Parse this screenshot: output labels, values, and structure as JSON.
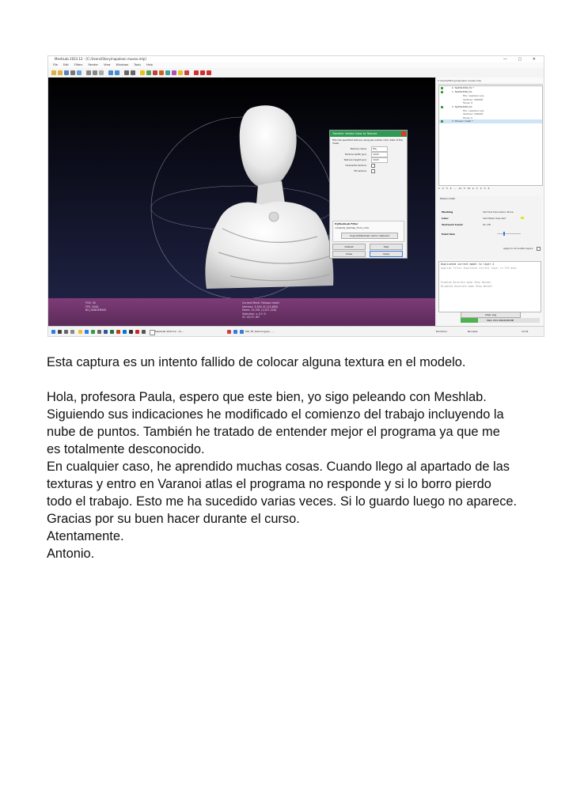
{
  "screenshot": {
    "window_title": "MeshLab 2023.12 - [C:/Users/iStory/napoleon museo.mlp]",
    "menu": [
      "File",
      "Edit",
      "Filters",
      "Render",
      "View",
      "Windows",
      "Tools",
      "Help"
    ],
    "window_controls": "—  ▢  ✕",
    "viewport_info_left": [
      "FOV: 30",
      "FPS: 2000",
      "BO_RENDERING"
    ],
    "viewport_info_right": [
      "Current Mesh: Poisson mesh",
      "Vertices: 3,540 (5,113,680)",
      "Faces: 15,291 (1,027,220)",
      "Selection: v: 0 f: 0",
      "VC VQ FC WT"
    ],
    "dialog": {
      "title": "Transfer: Vertex Color to Texture",
      "description": "Fills the specified texture using per-vertex color data of the mesh.",
      "fields": [
        {
          "label": "Texture name",
          "value": "file_"
        },
        {
          "label": "Texture width (px)",
          "value": "1024"
        },
        {
          "label": "Texture height (px)",
          "value": "1024"
        }
      ],
      "checks": [
        "Overwrite texture",
        "Fill texture"
      ],
      "group_title": "PyMeshLab Filter",
      "group_line": "compute_texmap_from_color",
      "group_button": "Copy PyMeshLab call to clipboard",
      "buttons": [
        "Default",
        "Help",
        "Close",
        "Apply"
      ]
    },
    "sidebar": {
      "path": "C:/Users/iStory/napoleon museo.mlp",
      "layers": [
        {
          "id": "0",
          "name": "NAPOLEON_fix *"
        },
        {
          "id": "1",
          "name": "NAPOLEON_fix"
        },
        {
          "id": "2",
          "name": "NAPOLEON_fix"
        },
        {
          "id": "3",
          "name": "Poisson mesh *"
        }
      ],
      "layer1_info": [
        "File: napoleon.ply",
        "Vertices: 400000",
        "Faces: 0"
      ],
      "layer2_info": [
        "File: napoleon.ply",
        "Vertices: 399000",
        "Faces: 0"
      ],
      "layer_nav": "1 2 3 4 … 11 ▾ 11 ▸ 1 2 3 4",
      "project_label": "Poisson mesh",
      "props": {
        "meshing_label": "Meshing",
        "meshing_values": "Vert  Dot Decoration  None",
        "color_label": "Color",
        "color_values": "Vert  Mesh  User-Def",
        "texcoord_label": "TexCoord Coord",
        "texcoord_values": "On  Off",
        "point_size_label": "Point Size",
        "apply_all": "apply to all visible layers"
      },
      "log": [
        "Duplicated current model to layer 4",
        "Applied filter Duplicate Current layer in 276 msec",
        "Enabled Decorate mode Show Normal",
        "Disabled Decorate mode Show Normal"
      ],
      "clear_log": "Clear Log",
      "memory": "Mem 22% 636/2048 MB",
      "memory_fraction": 0.22
    },
    "taskbar": {
      "items": [
        "MeshLab 2023.12 - [C...",
        "MD_TE_Texturing.ply - ..."
      ],
      "right": [
        "Escritorio",
        "Nivcales",
        "12:01"
      ]
    }
  },
  "text": {
    "caption": "Esta captura es un intento fallido de colocar alguna textura en el modelo.",
    "lines": [
      "Hola, profesora Paula, espero que este bien, yo sigo peleando con Meshlab.",
      "Siguiendo sus indicaciones he modificado el comienzo del trabajo incluyendo la",
      "nube de puntos. También he tratado de entender mejor el programa ya que me",
      "es totalmente desconocido.",
      "En cualquier caso, he aprendido muchas cosas. Cuando llego al apartado de las",
      "texturas y entro en Varanoi atlas el programa no responde y si lo borro pierdo",
      "todo el trabajo. Esto me ha sucedido varias veces. Si lo guardo luego no aparece.",
      "Gracias por su buen hacer durante el curso.",
      "Atentamente.",
      "Antonio."
    ]
  }
}
